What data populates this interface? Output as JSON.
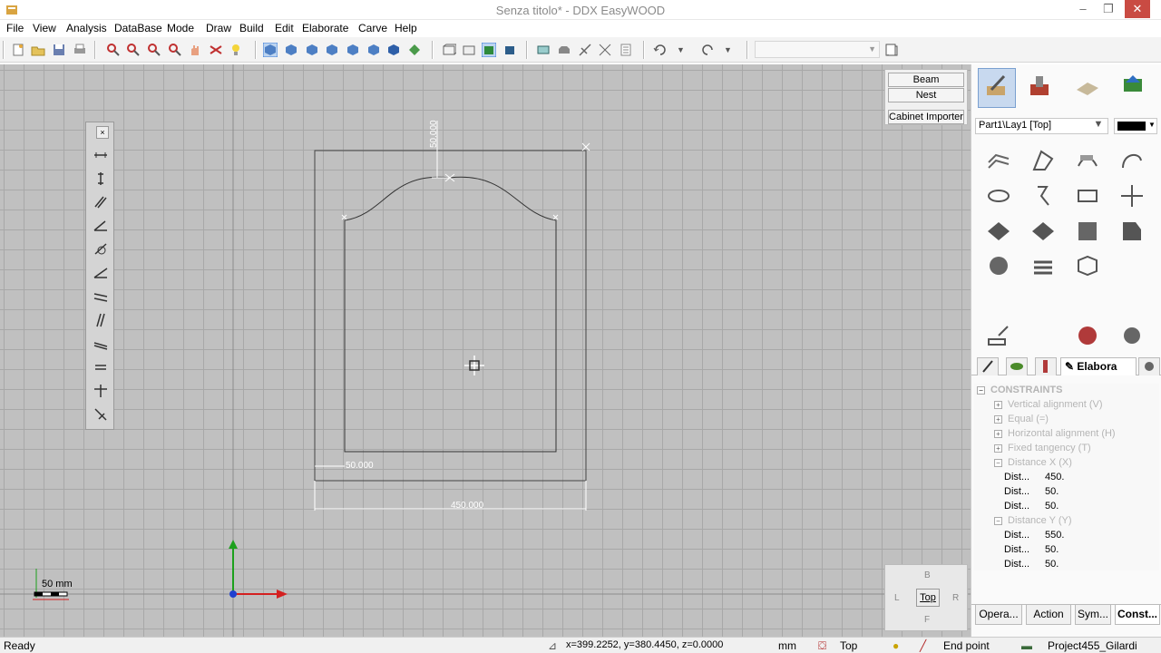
{
  "window": {
    "title": "Senza titolo* - DDX EasyWOOD",
    "minimize": "–",
    "restore": "❐",
    "close": "✕"
  },
  "menu": [
    "File",
    "View",
    "Analysis",
    "DataBase",
    "Mode",
    "Draw",
    "Build",
    "Edit",
    "Elaborate",
    "Carve",
    "Help"
  ],
  "buttons": {
    "beam": "Beam",
    "nest": "Nest",
    "cabinet_importer": "Cabinet Importer"
  },
  "drawing": {
    "dim_top": "50.000",
    "dim_left": "50.000",
    "dim_bottom": "450.000"
  },
  "scale": {
    "label": "50 mm"
  },
  "viewcube": {
    "back": "B",
    "left": "L",
    "current": "Top",
    "right": "R",
    "front": "F"
  },
  "right_panel": {
    "layer": "Part1\\Lay1 [Top]",
    "layer_color": "#000000",
    "active_tab": "Elabora"
  },
  "tree": {
    "root": "CONSTRAINTS",
    "items": [
      "Vertical alignment (V)",
      "Equal (=)",
      "Horizontal alignment (H)",
      "Fixed tangency (T)",
      "Distance X (X)"
    ],
    "distance_x_rows": [
      {
        "k": "Dist...",
        "v": "450."
      },
      {
        "k": "Dist...",
        "v": "50."
      },
      {
        "k": "Dist...",
        "v": "50."
      }
    ],
    "distance_y": "Distance Y (Y)",
    "distance_y_rows": [
      {
        "k": "Dist...",
        "v": "550."
      },
      {
        "k": "Dist...",
        "v": "50."
      },
      {
        "k": "Dist...",
        "v": "50."
      }
    ]
  },
  "bottom_tabs": [
    "Opera...",
    "Action",
    "Sym...",
    "Const..."
  ],
  "status": {
    "ready": "Ready",
    "coords": "x=399.2252, y=380.4450, z=0.0000",
    "units": "mm",
    "view": "Top",
    "snap": "End point",
    "project": "Project455_Gilardi"
  },
  "colors": {
    "accent": "#3b7dd8",
    "close": "#c94b43",
    "canvas": "#c0c0c0"
  }
}
